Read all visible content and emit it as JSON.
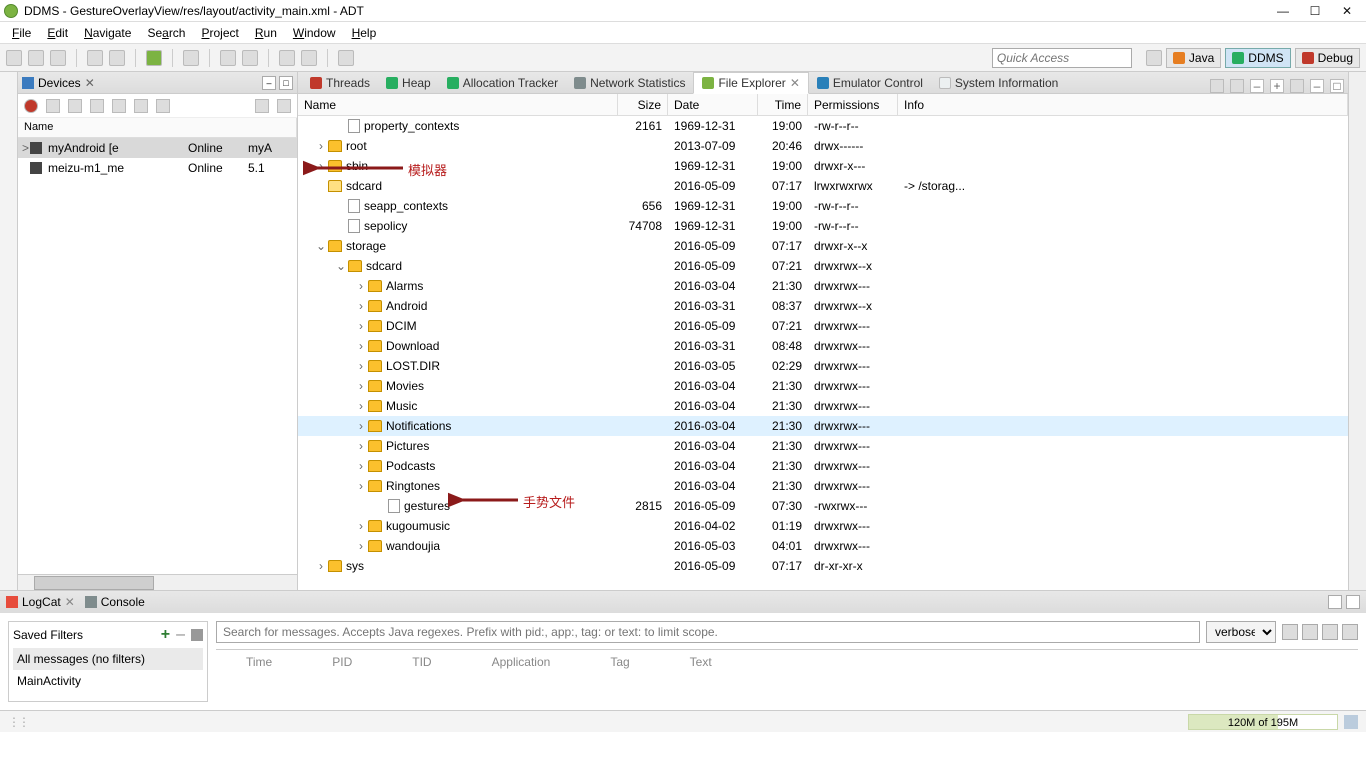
{
  "window": {
    "title": "DDMS - GestureOverlayView/res/layout/activity_main.xml - ADT"
  },
  "menu": {
    "file": "File",
    "edit": "Edit",
    "navigate": "Navigate",
    "search": "Search",
    "project": "Project",
    "run": "Run",
    "window": "Window",
    "help": "Help"
  },
  "toolbar": {
    "quick_access": "Quick Access",
    "persp_java": "Java",
    "persp_ddms": "DDMS",
    "persp_debug": "Debug"
  },
  "devices": {
    "title": "Devices",
    "col_name": "Name",
    "rows": [
      {
        "name": "myAndroid [e",
        "status": "Online",
        "ver": "myA",
        "sel": true
      },
      {
        "name": "meizu-m1_me",
        "status": "Online",
        "ver": "5.1",
        "sel": false
      }
    ]
  },
  "explorer": {
    "tabs": {
      "threads": "Threads",
      "heap": "Heap",
      "alloc": "Allocation Tracker",
      "net": "Network Statistics",
      "file": "File Explorer",
      "emu": "Emulator Control",
      "sys": "System Information"
    },
    "cols": {
      "name": "Name",
      "size": "Size",
      "date": "Date",
      "time": "Time",
      "perm": "Permissions",
      "info": "Info"
    },
    "rows": [
      {
        "indent": 1,
        "type": "file",
        "name": "property_contexts",
        "size": "2161",
        "date": "1969-12-31",
        "time": "19:00",
        "perm": "-rw-r--r--",
        "info": ""
      },
      {
        "indent": 0,
        "type": "folder",
        "exp": ">",
        "name": "root",
        "size": "",
        "date": "2013-07-09",
        "time": "20:46",
        "perm": "drwx------",
        "info": ""
      },
      {
        "indent": 0,
        "type": "folder",
        "exp": ">",
        "name": "sbin",
        "size": "",
        "date": "1969-12-31",
        "time": "19:00",
        "perm": "drwxr-x---",
        "info": ""
      },
      {
        "indent": 0,
        "type": "folderlink",
        "exp": "",
        "name": "sdcard",
        "size": "",
        "date": "2016-05-09",
        "time": "07:17",
        "perm": "lrwxrwxrwx",
        "info": "-> /storag..."
      },
      {
        "indent": 1,
        "type": "file",
        "name": "seapp_contexts",
        "size": "656",
        "date": "1969-12-31",
        "time": "19:00",
        "perm": "-rw-r--r--",
        "info": ""
      },
      {
        "indent": 1,
        "type": "file",
        "name": "sepolicy",
        "size": "74708",
        "date": "1969-12-31",
        "time": "19:00",
        "perm": "-rw-r--r--",
        "info": ""
      },
      {
        "indent": 0,
        "type": "folder",
        "exp": "v",
        "name": "storage",
        "size": "",
        "date": "2016-05-09",
        "time": "07:17",
        "perm": "drwxr-x--x",
        "info": ""
      },
      {
        "indent": 1,
        "type": "folder",
        "exp": "v",
        "name": "sdcard",
        "size": "",
        "date": "2016-05-09",
        "time": "07:21",
        "perm": "drwxrwx--x",
        "info": ""
      },
      {
        "indent": 2,
        "type": "folder",
        "exp": ">",
        "name": "Alarms",
        "size": "",
        "date": "2016-03-04",
        "time": "21:30",
        "perm": "drwxrwx---",
        "info": ""
      },
      {
        "indent": 2,
        "type": "folder",
        "exp": ">",
        "name": "Android",
        "size": "",
        "date": "2016-03-31",
        "time": "08:37",
        "perm": "drwxrwx--x",
        "info": ""
      },
      {
        "indent": 2,
        "type": "folder",
        "exp": ">",
        "name": "DCIM",
        "size": "",
        "date": "2016-05-09",
        "time": "07:21",
        "perm": "drwxrwx---",
        "info": ""
      },
      {
        "indent": 2,
        "type": "folder",
        "exp": ">",
        "name": "Download",
        "size": "",
        "date": "2016-03-31",
        "time": "08:48",
        "perm": "drwxrwx---",
        "info": ""
      },
      {
        "indent": 2,
        "type": "folder",
        "exp": ">",
        "name": "LOST.DIR",
        "size": "",
        "date": "2016-03-05",
        "time": "02:29",
        "perm": "drwxrwx---",
        "info": ""
      },
      {
        "indent": 2,
        "type": "folder",
        "exp": ">",
        "name": "Movies",
        "size": "",
        "date": "2016-03-04",
        "time": "21:30",
        "perm": "drwxrwx---",
        "info": ""
      },
      {
        "indent": 2,
        "type": "folder",
        "exp": ">",
        "name": "Music",
        "size": "",
        "date": "2016-03-04",
        "time": "21:30",
        "perm": "drwxrwx---",
        "info": ""
      },
      {
        "indent": 2,
        "type": "folder",
        "exp": ">",
        "name": "Notifications",
        "size": "",
        "date": "2016-03-04",
        "time": "21:30",
        "perm": "drwxrwx---",
        "info": "",
        "hl": true
      },
      {
        "indent": 2,
        "type": "folder",
        "exp": ">",
        "name": "Pictures",
        "size": "",
        "date": "2016-03-04",
        "time": "21:30",
        "perm": "drwxrwx---",
        "info": ""
      },
      {
        "indent": 2,
        "type": "folder",
        "exp": ">",
        "name": "Podcasts",
        "size": "",
        "date": "2016-03-04",
        "time": "21:30",
        "perm": "drwxrwx---",
        "info": ""
      },
      {
        "indent": 2,
        "type": "folder",
        "exp": ">",
        "name": "Ringtones",
        "size": "",
        "date": "2016-03-04",
        "time": "21:30",
        "perm": "drwxrwx---",
        "info": ""
      },
      {
        "indent": 3,
        "type": "file",
        "name": "gestures",
        "size": "2815",
        "date": "2016-05-09",
        "time": "07:30",
        "perm": "-rwxrwx---",
        "info": ""
      },
      {
        "indent": 2,
        "type": "folder",
        "exp": ">",
        "name": "kugoumusic",
        "size": "",
        "date": "2016-04-02",
        "time": "01:19",
        "perm": "drwxrwx---",
        "info": ""
      },
      {
        "indent": 2,
        "type": "folder",
        "exp": ">",
        "name": "wandoujia",
        "size": "",
        "date": "2016-05-03",
        "time": "04:01",
        "perm": "drwxrwx---",
        "info": ""
      },
      {
        "indent": 0,
        "type": "folder",
        "exp": ">",
        "name": "sys",
        "size": "",
        "date": "2016-05-09",
        "time": "07:17",
        "perm": "dr-xr-xr-x",
        "info": ""
      }
    ]
  },
  "annotations": {
    "emulator": "模拟器",
    "gesture": "手势文件"
  },
  "logcat": {
    "tab_logcat": "LogCat",
    "tab_console": "Console",
    "saved_filters": "Saved Filters",
    "filter_all": "All messages (no filters)",
    "filter_main": "MainActivity",
    "search_placeholder": "Search for messages. Accepts Java regexes. Prefix with pid:, app:, tag: or text: to limit scope.",
    "level": "verbose",
    "cols": {
      "time": "Time",
      "pid": "PID",
      "tid": "TID",
      "app": "Application",
      "tag": "Tag",
      "text": "Text"
    }
  },
  "status": {
    "heap": "120M of 195M"
  }
}
